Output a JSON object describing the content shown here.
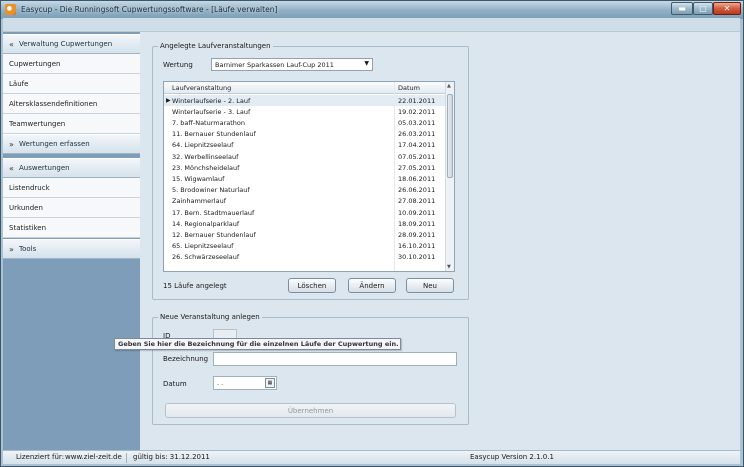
{
  "window": {
    "title": "Easycup - Die Runningsoft Cupwertungssoftware - [Läufe verwalten]",
    "min_glyph": "▬",
    "max_glyph": "▢",
    "close_glyph": "✕"
  },
  "sidebar": {
    "groups": [
      {
        "chevron": "«",
        "label": "Verwaltung Cupwertungen"
      },
      {
        "chevron": "»",
        "label": "Wertungen erfassen"
      },
      {
        "chevron": "«",
        "label": "Auswertungen"
      },
      {
        "chevron": "»",
        "label": "Tools"
      }
    ],
    "verwaltung_items": [
      "Cupwertungen",
      "Läufe",
      "Altersklassendefinitionen",
      "Teamwertungen"
    ],
    "auswertung_items": [
      "Listendruck",
      "Urkunden",
      "Statistiken"
    ]
  },
  "laufe": {
    "group_title": "Angelegte Laufveranstaltungen",
    "wertung_label": "Wertung",
    "wertung_value": "Barnimer Sparkassen Lauf-Cup 2011",
    "columns": [
      "Laufveranstaltung",
      "Datum"
    ],
    "rows": [
      {
        "name": "Winterlaufserie - 2. Lauf",
        "date": "22.01.2011"
      },
      {
        "name": "Winterlaufserie - 3. Lauf",
        "date": "19.02.2011"
      },
      {
        "name": "7. baff-Naturmarathon",
        "date": "05.03.2011"
      },
      {
        "name": "11. Bernauer Stundenlauf",
        "date": "26.03.2011"
      },
      {
        "name": "64. Liepnitzseelauf",
        "date": "17.04.2011"
      },
      {
        "name": "32. Werbellinseelauf",
        "date": "07.05.2011"
      },
      {
        "name": "23. Mönchsheidelauf",
        "date": "27.05.2011"
      },
      {
        "name": "15. Wigwamlauf",
        "date": "18.06.2011"
      },
      {
        "name": "5. Brodowiner Naturlauf",
        "date": "26.06.2011"
      },
      {
        "name": "Zainhammerlauf",
        "date": "27.08.2011"
      },
      {
        "name": "17. Bern. Stadtmauerlauf",
        "date": "10.09.2011"
      },
      {
        "name": "14. Regionalparklauf",
        "date": "18.09.2011"
      },
      {
        "name": "12. Bernauer Stundenlauf",
        "date": "28.09.2011"
      },
      {
        "name": "65. Liepnitzseelauf",
        "date": "16.10.2011"
      },
      {
        "name": "26. Schwärzeseelauf",
        "date": "30.10.2011"
      }
    ],
    "count_text": "15 Läufe angelegt",
    "btn_loeschen": "Löschen",
    "btn_aendern": "Ändern",
    "btn_neu": "Neu"
  },
  "neu": {
    "group_title": "Neue Veranstaltung anlegen",
    "id_label": "ID",
    "bezeichnung_label": "Bezeichnung",
    "datum_label": "Datum",
    "datum_value": " .  .",
    "btn_uebernehmen": "Übernehmen",
    "tooltip": "Geben Sie hier die Bezeichnung für die einzelnen Läufe der Cupwertung ein."
  },
  "status": {
    "lizenz_label": "Lizenziert für:",
    "lizenz_value": "www.ziel-zeit.de",
    "gueltig": "gültig bis: 31.12.2011",
    "version": "Easycup Version 2.1.0.1"
  }
}
